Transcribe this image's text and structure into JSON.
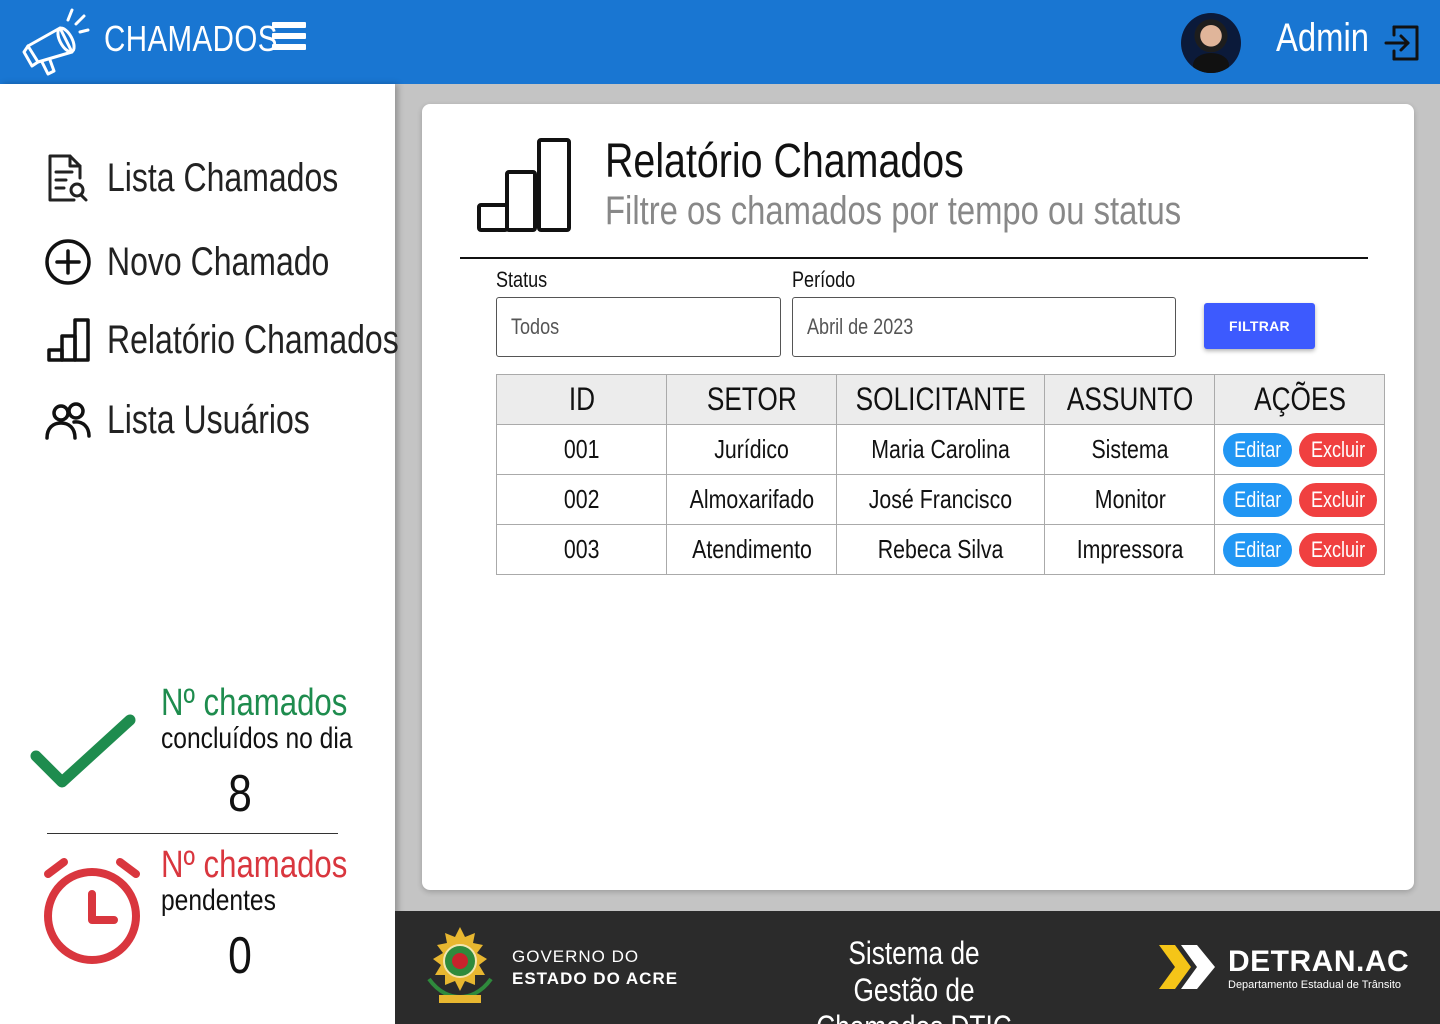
{
  "header": {
    "app_title": "CHAMADOS",
    "user_name": "Admin"
  },
  "sidebar": {
    "items": [
      {
        "label": "Lista Chamados",
        "icon": "document-search-icon"
      },
      {
        "label": "Novo Chamado",
        "icon": "add-circle-icon"
      },
      {
        "label": "Relatório Chamados",
        "icon": "bar-chart-icon"
      },
      {
        "label": "Lista Usuários",
        "icon": "users-icon"
      }
    ],
    "stats": {
      "completed": {
        "title": "Nº chamados",
        "subtitle": "concluídos no dia",
        "value": "8",
        "color": "#1e8c4e"
      },
      "pending": {
        "title": "Nº chamados",
        "subtitle": "pendentes",
        "value": "0",
        "color": "#d9363e"
      }
    }
  },
  "main": {
    "title": "Relatório Chamados",
    "subtitle": "Filtre os chamados por tempo ou status",
    "filters": {
      "status_label": "Status",
      "status_value": "Todos",
      "period_label": "Período",
      "period_value": "Abril de 2023",
      "button_label": "FILTRAR"
    },
    "table": {
      "columns": [
        "ID",
        "SETOR",
        "SOLICITANTE",
        "ASSUNTO",
        "AÇÕES"
      ],
      "rows": [
        {
          "id": "001",
          "setor": "Jurídico",
          "solicitante": "Maria Carolina",
          "assunto": "Sistema"
        },
        {
          "id": "002",
          "setor": "Almoxarifado",
          "solicitante": "José Francisco",
          "assunto": "Monitor"
        },
        {
          "id": "003",
          "setor": "Atendimento",
          "solicitante": "Rebeca Silva",
          "assunto": "Impressora"
        }
      ],
      "edit_label": "Editar",
      "delete_label": "Excluir"
    }
  },
  "footer": {
    "gov_line1": "GOVERNO DO",
    "gov_line2": "ESTADO DO ACRE",
    "system_name": "Sistema de Gestão de Chamados DTIC",
    "detran_name": "DETRAN.AC",
    "detran_subtitle": "Departamento Estadual de Trânsito"
  },
  "colors": {
    "header_blue": "#1976d2",
    "filter_button": "#3d5afe",
    "edit_button": "#2196f3",
    "delete_button": "#f04040",
    "footer_bg": "#2b2b2b",
    "detran_yellow": "#f5c518"
  }
}
